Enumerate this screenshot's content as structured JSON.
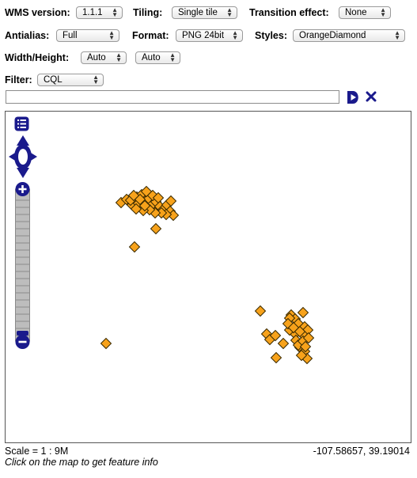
{
  "controls": {
    "wms_version": {
      "label": "WMS version:",
      "value": "1.1.1"
    },
    "tiling": {
      "label": "Tiling:",
      "value": "Single tile"
    },
    "transition": {
      "label": "Transition effect:",
      "value": "None"
    },
    "antialias": {
      "label": "Antialias:",
      "value": "Full"
    },
    "format": {
      "label": "Format:",
      "value": "PNG 24bit"
    },
    "styles": {
      "label": "Styles:",
      "value": "OrangeDiamond"
    },
    "size": {
      "label": "Width/Height:",
      "width_value": "Auto",
      "height_value": "Auto"
    },
    "filter": {
      "label": "Filter:",
      "value": "CQL",
      "text": ""
    }
  },
  "status": {
    "scale": "Scale = 1 : 9M",
    "coordinates": "-107.58657, 39.19014",
    "hint": "Click on the map to get feature info"
  },
  "colors": {
    "marker_fill": "#f7a21b",
    "marker_stroke": "#3a2a00",
    "control_blue": "#1a1a8c",
    "zoom_track": "#bdbdbd"
  },
  "icons": {
    "apply": "play-triangle-icon",
    "reset": "x-close-icon",
    "layer_switcher": "layer-list-icon",
    "pan": "pan-arrows-icon",
    "zoom_in": "plus-icon",
    "zoom_out": "minus-icon"
  }
}
